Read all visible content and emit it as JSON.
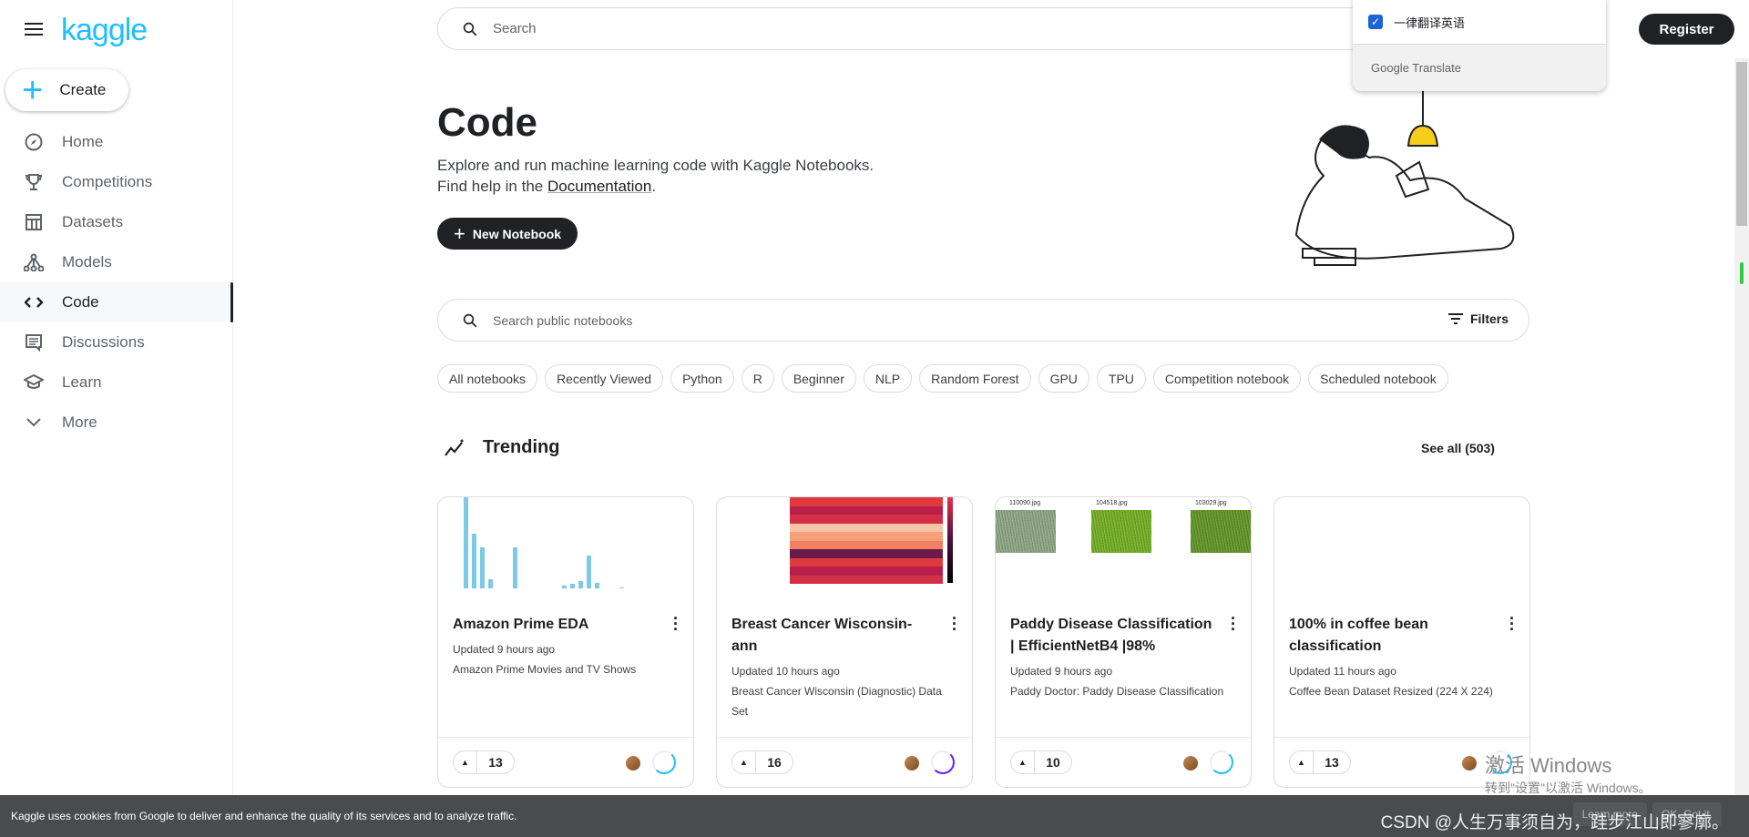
{
  "app": {
    "logo": "kaggle",
    "register_label": "Register",
    "search_placeholder": "Search"
  },
  "translate_popup": {
    "checkbox_label": "一律翻译英语",
    "checked": true,
    "brand": "Google Translate"
  },
  "sidebar": {
    "create_label": "Create",
    "active": "Code",
    "items": [
      {
        "label": "Home",
        "icon": "compass-icon"
      },
      {
        "label": "Competitions",
        "icon": "trophy-icon"
      },
      {
        "label": "Datasets",
        "icon": "table-icon"
      },
      {
        "label": "Models",
        "icon": "models-icon"
      },
      {
        "label": "Code",
        "icon": "code-icon"
      },
      {
        "label": "Discussions",
        "icon": "discussion-icon"
      },
      {
        "label": "Learn",
        "icon": "graduation-cap-icon"
      },
      {
        "label": "More",
        "icon": "chevron-down-icon"
      }
    ]
  },
  "main": {
    "title": "Code",
    "desc_line1": "Explore and run machine learning code with Kaggle Notebooks.",
    "desc_line2_prefix": "Find help in the ",
    "desc_link": "Documentation",
    "desc_suffix": ".",
    "new_notebook_label": "New Notebook",
    "notebook_search_placeholder": "Search public notebooks",
    "filters_label": "Filters",
    "chips": [
      "All notebooks",
      "Recently Viewed",
      "Python",
      "R",
      "Beginner",
      "NLP",
      "Random Forest",
      "GPU",
      "TPU",
      "Competition notebook",
      "Scheduled notebook"
    ],
    "trending": {
      "title": "Trending",
      "see_all": "See all (503)"
    },
    "cards": [
      {
        "title": "Amazon Prime EDA",
        "updated": "Updated 9 hours ago",
        "dataset": "Amazon Prime Movies and TV Shows",
        "votes": "13"
      },
      {
        "title": "Breast Cancer Wisconsin-ann",
        "updated": "Updated 10 hours ago",
        "dataset": "Breast Cancer Wisconsin (Diagnostic) Data Set",
        "votes": "16"
      },
      {
        "title": "Paddy Disease Classification | EfficientNetB4 |98%",
        "updated": "Updated 9 hours ago",
        "dataset": "Paddy Doctor: Paddy Disease Classification",
        "votes": "10"
      },
      {
        "title": "100% in coffee bean classification",
        "updated": "Updated 11 hours ago",
        "dataset": "Coffee Bean Dataset Resized (224 X 224)",
        "votes": "13"
      }
    ],
    "paddy_labels": [
      "110090.jpg",
      "104518.jpg",
      "103029.jpg"
    ]
  },
  "cookie": {
    "text": "Kaggle uses cookies from Google to deliver and enhance the quality of its services and to analyze traffic.",
    "learn_more": "Learn more",
    "ok": "OK, Got it."
  },
  "watermarks": {
    "csdn": "CSDN @人生万事须自为，跬步江山即寥廓。",
    "windows_line1": "激活 Windows",
    "windows_line2": "转到\"设置\"以激活 Windows。"
  },
  "colors": {
    "brand": "#20beff",
    "dark": "#202124",
    "cookie_bg": "#4a4b4f"
  }
}
